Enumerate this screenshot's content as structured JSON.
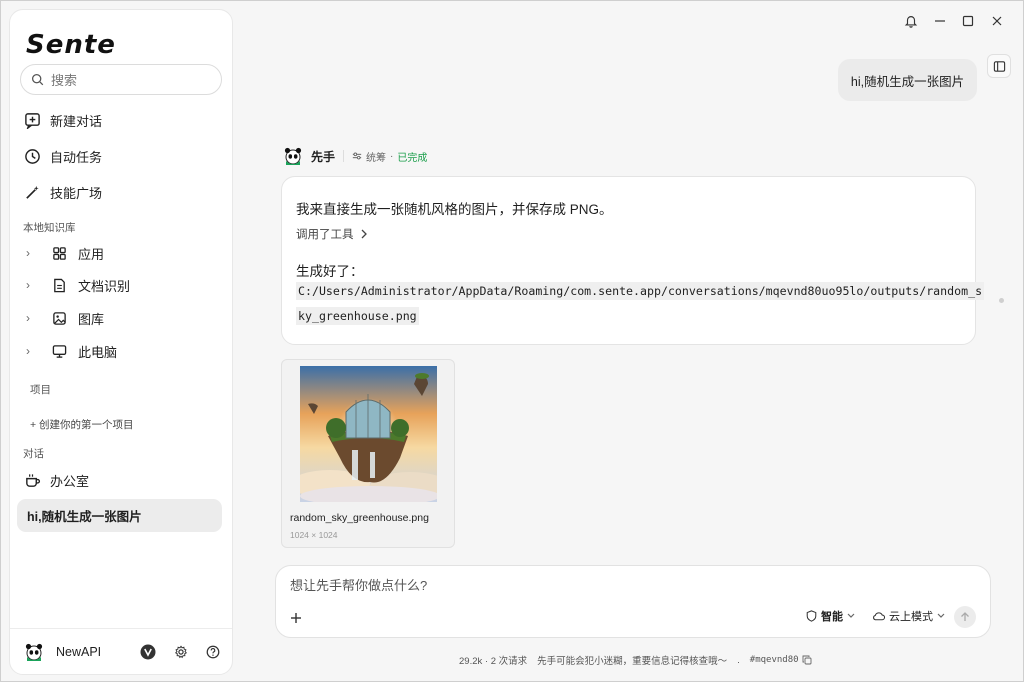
{
  "app": {
    "logo": "Sente"
  },
  "sidebar": {
    "search_placeholder": "搜索",
    "nav": [
      {
        "label": "新建对话",
        "icon": "new-chat-icon"
      },
      {
        "label": "自动任务",
        "icon": "clock-icon"
      },
      {
        "label": "技能广场",
        "icon": "magic-wand-icon"
      }
    ],
    "kb_section": "本地知识库",
    "kb_items": [
      {
        "label": "应用",
        "icon": "grid-icon"
      },
      {
        "label": "文档识别",
        "icon": "document-icon"
      },
      {
        "label": "图库",
        "icon": "image-icon"
      },
      {
        "label": "此电脑",
        "icon": "monitor-icon"
      }
    ],
    "projects_section": "项目",
    "create_project": "+ 创建你的第一个项目",
    "conversations_section": "对话",
    "conversations": [
      {
        "label": "办公室",
        "icon": "coffee-icon"
      },
      {
        "label": "hi,随机生成一张图片",
        "active": true
      }
    ],
    "footer": {
      "name": "NewAPI"
    }
  },
  "chat": {
    "user_message": "hi,随机生成一张图片",
    "assistant": {
      "name": "先手",
      "meta_label": "统筹",
      "status": "已完成",
      "line1": "我来直接生成一张随机风格的图片，并保存成 PNG。",
      "tool_line": "调用了工具",
      "done_line": "生成好了：",
      "path_part1": "C:/Users/Administrator/AppData/Roaming/com.sente.app/conversations/mqevnd80uo95lo/outputs/random_s",
      "path_part2": "ky_greenhouse.png"
    },
    "file": {
      "name": "random_sky_greenhouse.png",
      "dims": "1024 × 1024"
    }
  },
  "composer": {
    "placeholder": "想让先手帮你做点什么?",
    "mode1": "智能",
    "mode2": "云上模式"
  },
  "status_bar": {
    "tokens": "29.2k",
    "requests": "2 次请求",
    "disclaimer": "先手可能会犯小迷糊，重要信息记得核查哦〜",
    "conv_id": "#mqevnd80"
  }
}
